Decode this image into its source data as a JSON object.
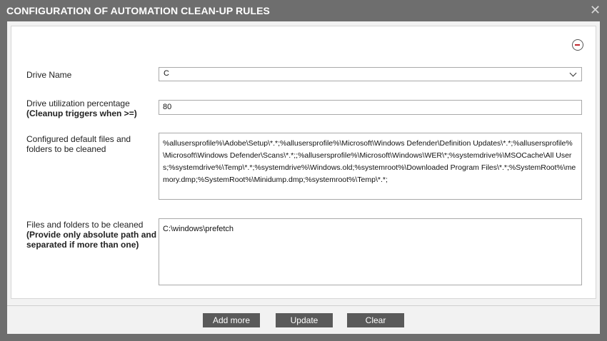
{
  "dialog": {
    "title": "CONFIGURATION OF AUTOMATION CLEAN-UP RULES",
    "close_glyph": "✕"
  },
  "form": {
    "remove_icon": "minus-circle-icon",
    "drive_name": {
      "label": "Drive Name",
      "selected": "C"
    },
    "utilization": {
      "label_line1": "Drive utilization percentage",
      "label_line2": "(Cleanup triggers when >=)",
      "value": "80"
    },
    "default_files": {
      "label_line1": "Configured default files and",
      "label_line2": "folders to be cleaned",
      "value": "%allusersprofile%\\Adobe\\Setup\\*.*;%allusersprofile%\\Microsoft\\Windows Defender\\Definition Updates\\*.*;%allusersprofile%\\Microsoft\\Windows Defender\\Scans\\*.*;;%allusersprofile%\\Microsoft\\Windows\\WER\\*;%systemdrive%\\MSOCache\\All Users;%systemdrive%\\Temp\\*.*;%systemdrive%\\Windows.old;%systemroot%\\Downloaded Program Files\\*.*;%SystemRoot%\\memory.dmp;%SystemRoot%\\Minidump.dmp;%systemroot%\\Temp\\*.*;"
    },
    "custom_files": {
      "label_line1": "Files and folders to be cleaned",
      "label_line2": "(Provide only absolute path and ;",
      "label_line3": "separated if more than one)",
      "value": "C:\\windows\\prefetch"
    }
  },
  "footer": {
    "add_more": "Add more",
    "update": "Update",
    "clear": "Clear"
  }
}
